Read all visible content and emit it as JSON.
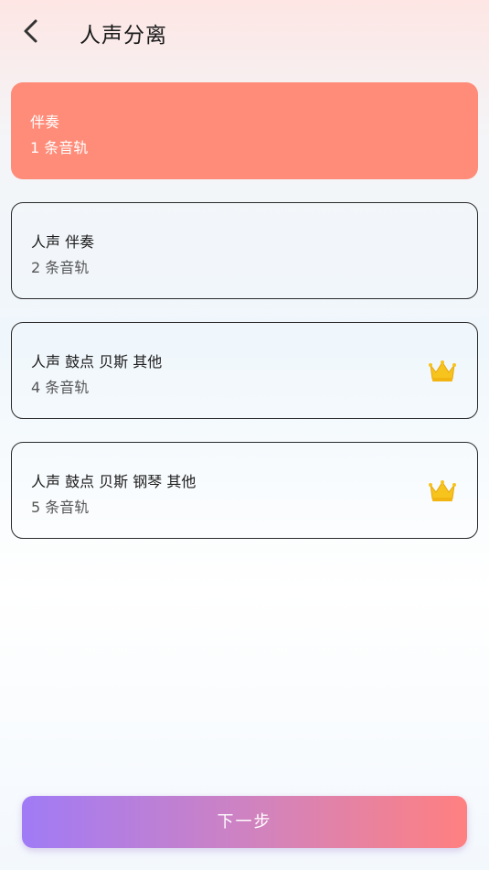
{
  "header": {
    "back_icon": "chevron-left-icon",
    "title": "人声分离"
  },
  "options": [
    {
      "title": "伴奏",
      "tracks": "1 条音轨",
      "selected": true,
      "premium": false
    },
    {
      "title": "人声 伴奏",
      "tracks": "2 条音轨",
      "selected": false,
      "premium": false
    },
    {
      "title": "人声 鼓点 贝斯 其他",
      "tracks": "4 条音轨",
      "selected": false,
      "premium": true
    },
    {
      "title": "人声 鼓点 贝斯 钢琴 其他",
      "tracks": "5 条音轨",
      "selected": false,
      "premium": true
    }
  ],
  "premium_icon": "crown-icon",
  "next_button": {
    "label": "下一步"
  },
  "colors": {
    "selected_card": "#ff8c79",
    "button_gradient_start": "#a07bf6",
    "button_gradient_end": "#ff8080",
    "crown": "#f7c31d"
  }
}
